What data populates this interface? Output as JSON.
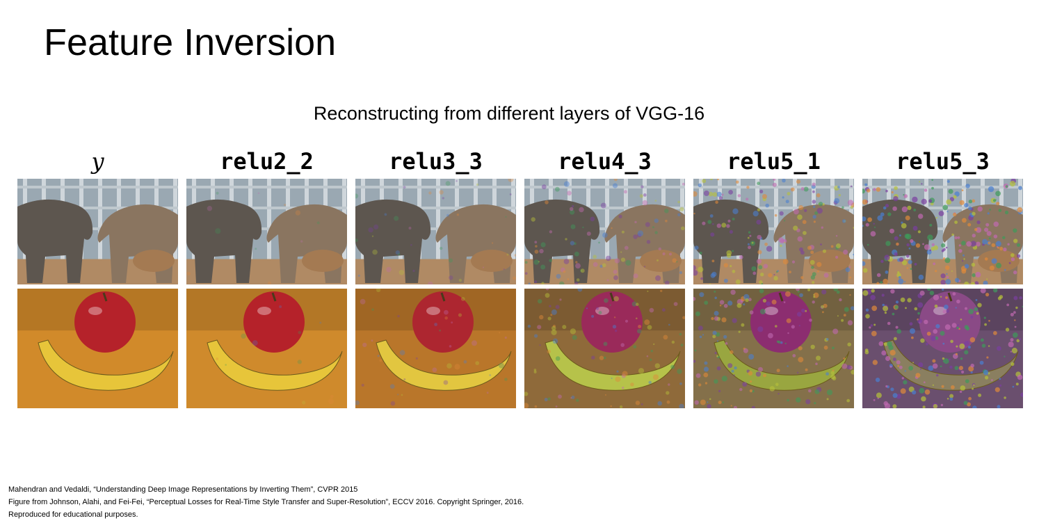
{
  "slide": {
    "title": "Feature Inversion",
    "subtitle": "Reconstructing from different layers of VGG-16"
  },
  "columns": [
    {
      "label": "y",
      "style": "original"
    },
    {
      "label": "relu2_2",
      "style": "reconstruction"
    },
    {
      "label": "relu3_3",
      "style": "reconstruction"
    },
    {
      "label": "relu4_3",
      "style": "reconstruction"
    },
    {
      "label": "relu5_1",
      "style": "reconstruction"
    },
    {
      "label": "relu5_3",
      "style": "reconstruction"
    }
  ],
  "rows": [
    {
      "subject": "elephants"
    },
    {
      "subject": "apple-and-banana"
    }
  ],
  "citations": [
    "Mahendran and Vedaldi, “Understanding Deep Image Representations by Inverting Them”, CVPR 2015",
    "Figure from Johnson, Alahi, and Fei-Fei, “Perceptual Losses for Real-Time Style Transfer and Super-Resolution”, ECCV 2016. Copyright Springer, 2016.",
    "Reproduced for educational purposes."
  ],
  "colors": {
    "background": "#ffffff",
    "text": "#000000"
  }
}
